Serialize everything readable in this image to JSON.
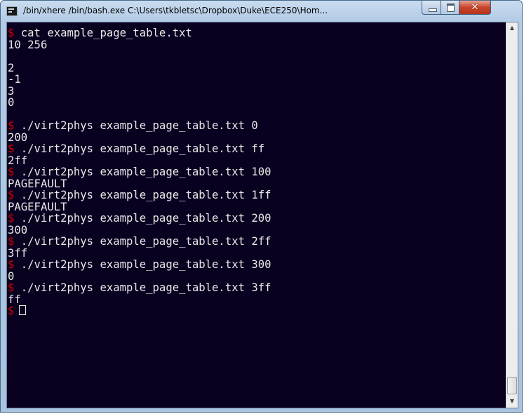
{
  "window": {
    "title": "/bin/xhere /bin/bash.exe C:\\Users\\tkbletsc\\Dropbox\\Duke\\ECE250\\Hom...",
    "controls": {
      "minimize_icon": "minimize-icon",
      "maximize_icon": "maximize-icon",
      "close_label": "✕"
    }
  },
  "terminal": {
    "background": "#0a0020",
    "text_color": "#e8e8e8",
    "prompt_color": "#cc0000",
    "prompt_symbol": "$",
    "lines": [
      {
        "prompt": "$",
        "text": " cat example_page_table.txt"
      },
      {
        "prompt": "",
        "text": "10 256"
      },
      {
        "prompt": "",
        "text": ""
      },
      {
        "prompt": "",
        "text": "2"
      },
      {
        "prompt": "",
        "text": "-1"
      },
      {
        "prompt": "",
        "text": "3"
      },
      {
        "prompt": "",
        "text": "0"
      },
      {
        "prompt": "",
        "text": ""
      },
      {
        "prompt": "$",
        "text": " ./virt2phys example_page_table.txt 0"
      },
      {
        "prompt": "",
        "text": "200"
      },
      {
        "prompt": "$",
        "text": " ./virt2phys example_page_table.txt ff"
      },
      {
        "prompt": "",
        "text": "2ff"
      },
      {
        "prompt": "$",
        "text": " ./virt2phys example_page_table.txt 100"
      },
      {
        "prompt": "",
        "text": "PAGEFAULT"
      },
      {
        "prompt": "$",
        "text": " ./virt2phys example_page_table.txt 1ff"
      },
      {
        "prompt": "",
        "text": "PAGEFAULT"
      },
      {
        "prompt": "$",
        "text": " ./virt2phys example_page_table.txt 200"
      },
      {
        "prompt": "",
        "text": "300"
      },
      {
        "prompt": "$",
        "text": " ./virt2phys example_page_table.txt 2ff"
      },
      {
        "prompt": "",
        "text": "3ff"
      },
      {
        "prompt": "$",
        "text": " ./virt2phys example_page_table.txt 300"
      },
      {
        "prompt": "",
        "text": "0"
      },
      {
        "prompt": "$",
        "text": " ./virt2phys example_page_table.txt 3ff"
      },
      {
        "prompt": "",
        "text": "ff"
      },
      {
        "prompt": "$",
        "text": "",
        "cursor": true
      }
    ]
  },
  "scrollbar": {
    "up_icon": "▲",
    "down_icon": "▼"
  }
}
